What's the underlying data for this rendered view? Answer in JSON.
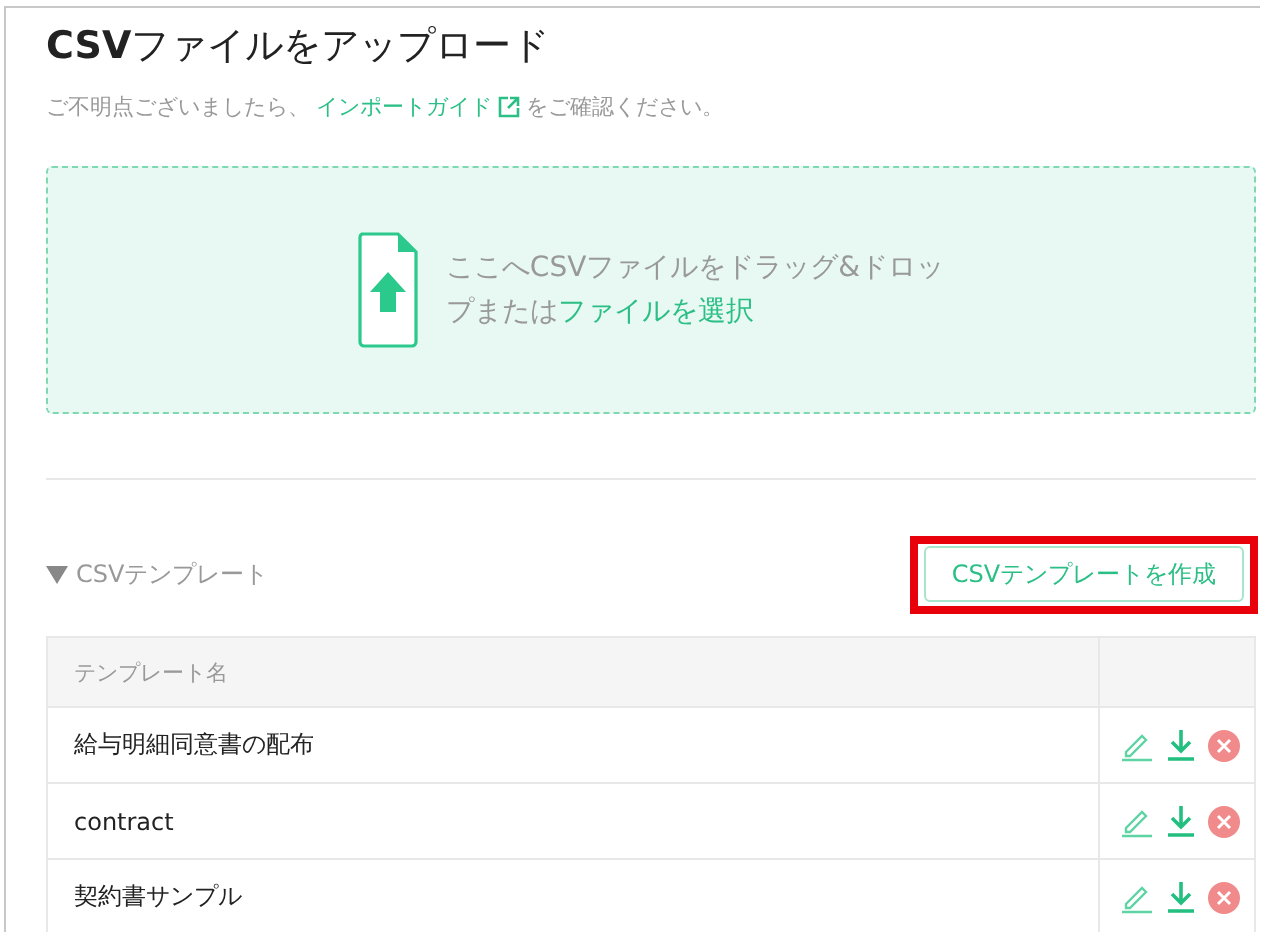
{
  "title": "**CSV**ファイルをアップロード",
  "help": {
    "before": "ご不明点ございましたら、",
    "link": "インポートガイド",
    "after": "をご確認ください。"
  },
  "dropzone": {
    "line1": "ここへCSVファイルをドラッグ&ドロッ",
    "line2_before": "プまたは",
    "line2_link": "ファイルを選択"
  },
  "templates": {
    "heading": "CSVテンプレート",
    "expanded": true,
    "create_button": {
      "label": "CSVテンプレートを作成",
      "highlighted": true
    },
    "columns": [
      "テンプレート名"
    ],
    "rows": [
      {
        "name": "給与明細同意書の配布"
      },
      {
        "name": "contract"
      },
      {
        "name": "契約書サンプル"
      }
    ]
  }
}
